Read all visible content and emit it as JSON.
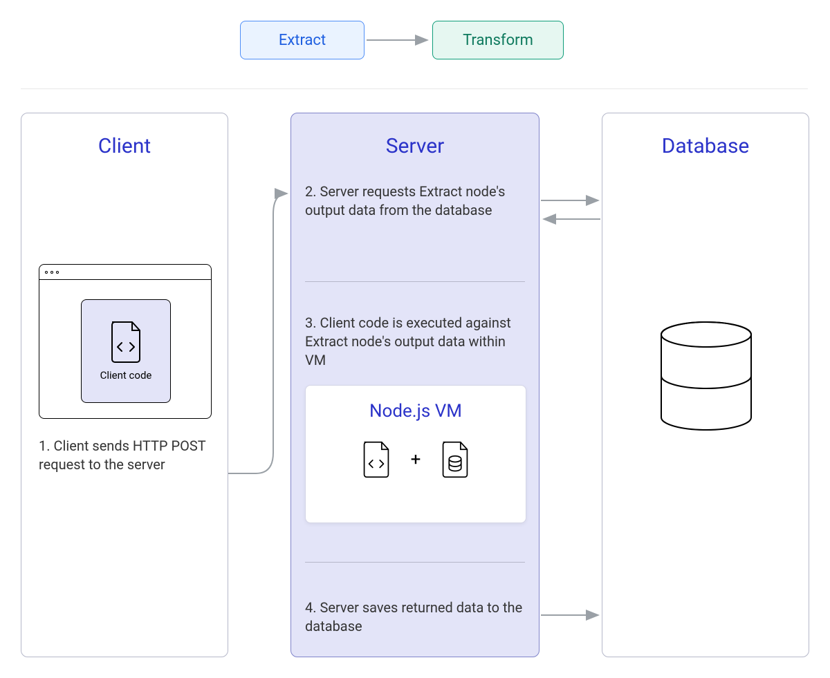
{
  "pipeline": {
    "extract_label": "Extract",
    "transform_label": "Transform"
  },
  "client": {
    "title": "Client",
    "code_card_label": "Client code",
    "step1": "1. Client sends HTTP POST request to the server"
  },
  "server": {
    "title": "Server",
    "step2": "2. Server requests Extract node's output data from the database",
    "step3": "3. Client code is executed against Extract node's output data within VM",
    "step4": "4. Server saves returned data to the database",
    "vm_title": "Node.js VM",
    "plus": "+"
  },
  "database": {
    "title": "Database"
  },
  "colors": {
    "accent_blue": "#2b33c9",
    "panel_server_bg": "#e3e4f8",
    "panel_server_border": "#7f83c9",
    "extract_border": "#4f8ef7",
    "extract_bg": "#eaf3ff",
    "extract_text": "#1e5fe0",
    "transform_border": "#0f9d7a",
    "transform_bg": "#e6f7f1",
    "transform_text": "#0f7a5e",
    "arrow": "#9aa0a6"
  }
}
